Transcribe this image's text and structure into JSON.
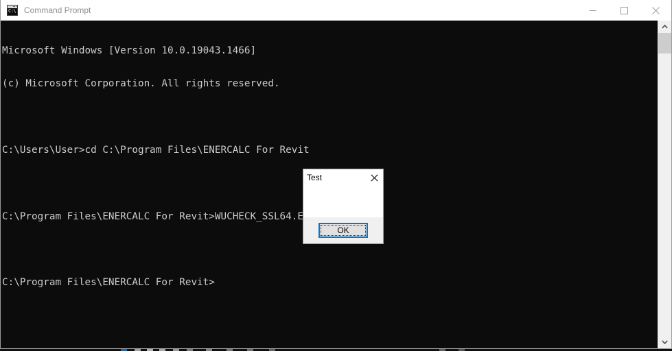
{
  "window": {
    "title": "Command Prompt",
    "icon": "command-prompt-icon",
    "icon_text": "C:\\",
    "controls": {
      "minimize_label": "Minimize",
      "maximize_label": "Maximize",
      "close_label": "Close"
    }
  },
  "console": {
    "lines": [
      "Microsoft Windows [Version 10.0.19043.1466]",
      "(c) Microsoft Corporation. All rights reserved.",
      "",
      "C:\\Users\\User>cd C:\\Program Files\\ENERCALC For Revit",
      "",
      "C:\\Program Files\\ENERCALC For Revit>WUCHECK_SSL64.EXE/c",
      "",
      "C:\\Program Files\\ENERCALC For Revit>"
    ],
    "text_color": "#cccccc",
    "background_color": "#0c0c0c"
  },
  "scrollbar": {
    "up_arrow": "chevron-up-icon",
    "down_arrow": "chevron-down-icon",
    "thumb_color": "#cdcdcd",
    "track_color": "#f0f0f0"
  },
  "dialog": {
    "title": "Test",
    "close_label": "Close",
    "body_text": "",
    "ok_label": "OK",
    "accent_color": "#0078d7",
    "footer_color": "#f0f0f0"
  },
  "taskbar": {
    "accent_color": "#2b6fc2"
  }
}
